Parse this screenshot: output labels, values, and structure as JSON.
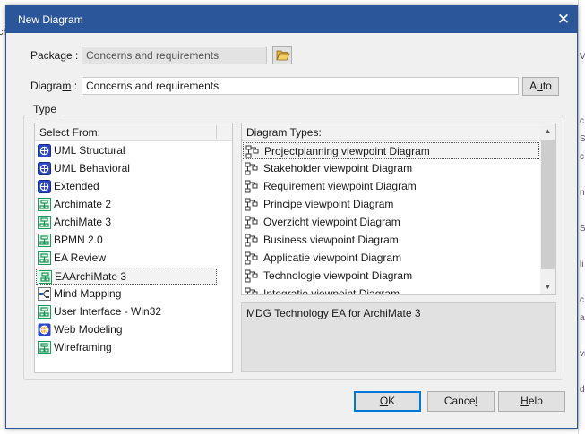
{
  "background": {
    "left_fragment": "ch",
    "right_fragments": [
      "V",
      "c",
      "S",
      "c",
      "n",
      "S",
      "li",
      "c",
      "a",
      "vi",
      "d"
    ]
  },
  "dialog": {
    "title": "New Diagram",
    "close_glyph": "✕"
  },
  "package": {
    "label_pre": "Packa",
    "label_ul": "g",
    "label_post": "e :",
    "value": "Concerns and requirements",
    "browse_icon": "folder-open-icon"
  },
  "diagram": {
    "label_pre": "Diagra",
    "label_ul": "m",
    "label_post": " :",
    "value": "Concerns and requirements",
    "auto_pre": "A",
    "auto_ul": "u",
    "auto_post": "to"
  },
  "type_group": {
    "label": "Type",
    "select_from": {
      "header": "Select From:",
      "items": [
        {
          "label": "UML Structural",
          "icon": "uml-icon"
        },
        {
          "label": "UML Behavioral",
          "icon": "uml-icon"
        },
        {
          "label": "Extended",
          "icon": "uml-icon"
        },
        {
          "label": "Archimate 2",
          "icon": "archimate-icon"
        },
        {
          "label": "ArchiMate 3",
          "icon": "archimate-icon"
        },
        {
          "label": "BPMN 2.0",
          "icon": "archimate-icon"
        },
        {
          "label": "EA Review",
          "icon": "archimate-icon"
        },
        {
          "label": "EAArchiMate 3",
          "icon": "archimate-icon",
          "selected": true
        },
        {
          "label": "Mind Mapping",
          "icon": "mindmap-icon"
        },
        {
          "label": "User Interface - Win32",
          "icon": "archimate-icon"
        },
        {
          "label": "Web Modeling",
          "icon": "web-modeling-icon"
        },
        {
          "label": "Wireframing",
          "icon": "archimate-icon"
        }
      ]
    },
    "diagram_types": {
      "header": "Diagram Types:",
      "items": [
        {
          "label": "Projectplanning viewpoint Diagram",
          "selected": true
        },
        {
          "label": "Stakeholder viewpoint Diagram"
        },
        {
          "label": "Requirement viewpoint Diagram"
        },
        {
          "label": "Principe viewpoint Diagram"
        },
        {
          "label": "Overzicht viewpoint Diagram"
        },
        {
          "label": "Business viewpoint Diagram"
        },
        {
          "label": "Applicatie viewpoint Diagram"
        },
        {
          "label": "Technologie viewpoint Diagram"
        },
        {
          "label": "Integratie viewpoint Diagram"
        }
      ],
      "scroll_up": "▲",
      "scroll_down": "▼"
    },
    "description": "MDG Technology EA for ArchiMate 3"
  },
  "buttons": {
    "ok_ul": "O",
    "ok_post": "K",
    "cancel_pre": "Cance",
    "cancel_ul": "l",
    "help_ul": "H",
    "help_post": "elp"
  },
  "colors": {
    "titlebar": "#2b579a",
    "accent": "#0078d7"
  }
}
